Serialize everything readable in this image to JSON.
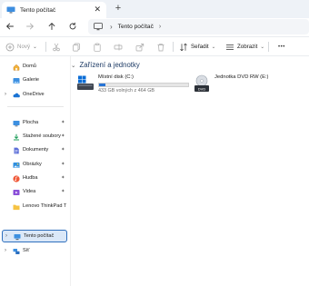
{
  "tab": {
    "title": "Tento počítač",
    "close": "✕",
    "new_tab": "+"
  },
  "address": {
    "separator": "›",
    "crumb": "Tento počítač",
    "dropdown": "›"
  },
  "toolbar": {
    "new_label": "Nový",
    "sort_label": "Seřadit",
    "view_label": "Zobrazit",
    "more_label": "•••",
    "chevron": "⌄"
  },
  "sidebar": {
    "items": [
      {
        "label": "Domů",
        "icon": "home-icon"
      },
      {
        "label": "Galerie",
        "icon": "gallery-icon"
      },
      {
        "label": "OneDrive",
        "icon": "cloud-icon",
        "expander": "›"
      },
      {
        "label": "Plocha",
        "icon": "desktop-icon",
        "pin": "📌"
      },
      {
        "label": "Stažené soubory",
        "icon": "download-icon",
        "pin": "📌"
      },
      {
        "label": "Dokumenty",
        "icon": "documents-icon",
        "pin": "📌"
      },
      {
        "label": "Obrázky",
        "icon": "pictures-icon",
        "pin": "📌"
      },
      {
        "label": "Hudba",
        "icon": "music-icon",
        "pin": "📌"
      },
      {
        "label": "Videa",
        "icon": "videos-icon",
        "pin": "📌"
      },
      {
        "label": "Lenovo ThinkPad T",
        "icon": "folder-icon"
      },
      {
        "label": "Tento počítač",
        "icon": "computer-icon",
        "expander": "›"
      },
      {
        "label": "Síť",
        "icon": "network-icon",
        "expander": "›"
      }
    ]
  },
  "main": {
    "group_chevron": "⌄",
    "group_title": "Zařízení a jednotky",
    "drives": [
      {
        "name": "Místní disk (C:)",
        "free_text": "433 GB volných z 464 GB",
        "used_fraction": 0.067
      },
      {
        "name": "Jednotka DVD RW (E:)"
      }
    ]
  },
  "colors": {
    "accent": "#2774d6",
    "selection": "#dbe8f8",
    "selection_border": "#2f6fbd"
  }
}
